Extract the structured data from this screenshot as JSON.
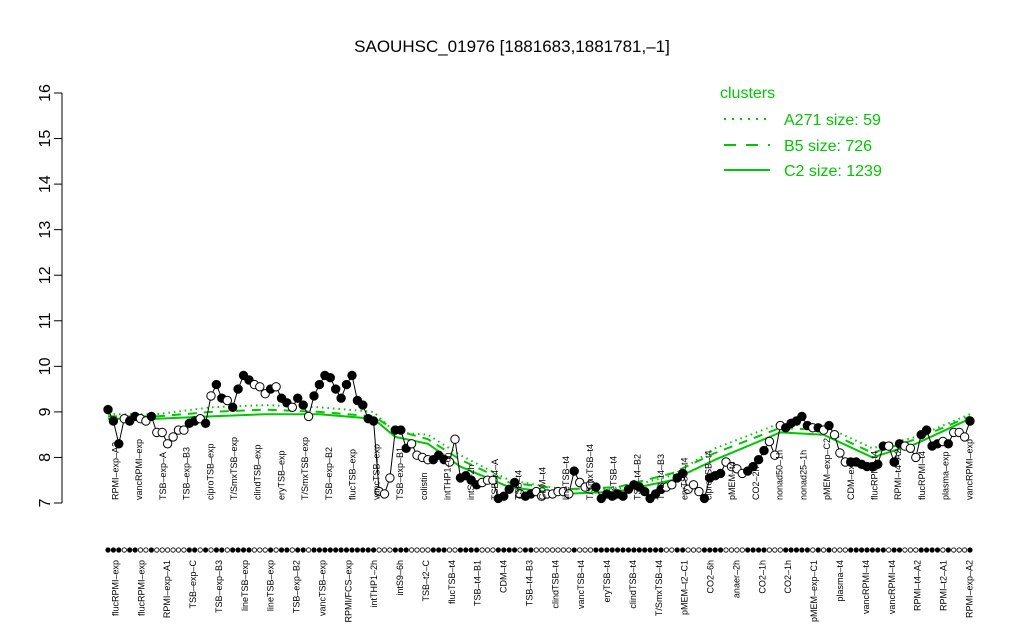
{
  "chart_data": {
    "type": "line",
    "title": "SAOUHSC_01976 [1881683,1881781,–1]",
    "xlabel": "",
    "ylabel": "",
    "ylim": [
      7,
      16
    ],
    "yticks": [
      7,
      8,
      9,
      10,
      11,
      12,
      13,
      14,
      15,
      16
    ],
    "grid": false,
    "legend": {
      "title": "clusters",
      "position": "top-right",
      "entries": [
        {
          "label": "A271 size: 59",
          "style": "dotted"
        },
        {
          "label": "B5 size: 726",
          "style": "dashed"
        },
        {
          "label": "C2 size: 1239",
          "style": "solid"
        }
      ]
    },
    "colors": {
      "series": "#00c800",
      "points": "#000000"
    },
    "top_labels": [
      "RPMI–exp–A2",
      "vancRPMI–exp",
      "TSB–exp–A",
      "TSB–exp–B3",
      "ciproTSB–exp",
      "T/SmxTSB–exp",
      "clindTSB–exp",
      "eryTSB–exp",
      "T/SmxTSB–exp",
      "TSB–exp–B2",
      "flucTSB–exp",
      "vancTSB–exp",
      "TSB–exp–B1",
      "colistin",
      "intTHP1–6h",
      "intS9–2h",
      "TSB–t4–A",
      "TSB–t4",
      "CDM–t4",
      "lineTSB–t4",
      "T/SmxTSB–t4",
      "lineTSB–t4",
      "TSB–t4–B2",
      "TSB–t4–B3",
      "eryTSB–t4",
      "ciproTSB–t4",
      "pMEM–t4",
      "CO2–2h",
      "nonad50–1h",
      "nonad25–1h",
      "pMEM–exp–C2",
      "CDM–exp",
      "flucRPMI–t4",
      "RPMI–t4–A2",
      "flucRPMI–t4",
      "plasma–exp",
      "vancRPMI–exp"
    ],
    "bottom_labels": [
      "flucRPMI–exp",
      "flucRPMI–exp",
      "RPMI–exp–A1",
      "TSB–exp–C",
      "TSB–exp–B3",
      "lineTSB–exp",
      "lineTSB–exp",
      "TSB–exp–B2",
      "vancTSB–exp",
      "RPMI/FCS–exp",
      "intTHP1–2h",
      "intS9–6h",
      "TSB–t2–C",
      "flucTSB–t4",
      "TSB–t4–B1",
      "CDM–t4",
      "TSB–t4–B3",
      "clindTSB–t4",
      "vancTSB–t4",
      "eryTSB–t4",
      "clindTSB–t4",
      "T/SmxTSB–t4",
      "pMEM–t2–C1",
      "CO2–6h",
      "anaer–2h",
      "CO2–1h",
      "CO2–1h",
      "pMEM–exp–C1",
      "plasma–t4",
      "vancRPMI–t4",
      "vancRPMI–t4",
      "RPMI–t4–A2",
      "RPMI–t2–A1",
      "RPMI–exp–A2"
    ],
    "x": [
      1,
      2,
      3,
      4,
      5,
      6,
      7,
      8,
      9,
      10,
      11,
      12,
      13,
      14,
      15,
      16,
      17,
      18,
      19,
      20,
      21,
      22,
      23,
      24,
      25,
      26,
      27,
      28,
      29,
      30,
      31,
      32,
      33,
      34,
      35,
      36,
      37,
      38,
      39,
      40,
      41,
      42,
      43,
      44,
      45,
      46,
      47,
      48,
      49,
      50,
      51,
      52,
      53,
      54,
      55,
      56,
      57,
      58,
      59,
      60,
      61,
      62,
      63,
      64,
      65,
      66,
      67,
      68,
      69,
      70,
      71,
      72,
      73,
      74,
      75,
      76,
      77,
      78,
      79,
      80,
      81,
      82,
      83,
      84,
      85,
      86,
      87,
      88,
      89,
      90,
      91,
      92,
      93,
      94,
      95,
      96,
      97,
      98,
      99,
      100,
      101,
      102,
      103,
      104,
      105,
      106,
      107,
      108,
      109,
      110,
      111,
      112,
      113,
      114,
      115,
      116,
      117,
      118,
      119,
      120,
      121,
      122,
      123,
      124,
      125,
      126,
      127,
      128,
      129,
      130,
      131,
      132,
      133,
      134,
      135,
      136,
      137,
      138,
      139,
      140,
      141,
      142,
      143,
      144,
      145,
      146,
      147,
      148,
      149,
      150,
      151,
      152,
      153,
      154,
      155,
      156,
      157,
      158,
      159,
      160
    ],
    "values": [
      9.05,
      8.8,
      8.3,
      8.85,
      8.8,
      8.9,
      8.85,
      8.8,
      8.9,
      8.55,
      8.55,
      8.3,
      8.45,
      8.6,
      8.6,
      8.75,
      8.8,
      8.85,
      8.75,
      9.35,
      9.6,
      9.3,
      9.25,
      9.1,
      9.5,
      9.8,
      9.7,
      9.6,
      9.55,
      9.4,
      9.5,
      9.55,
      9.3,
      9.2,
      9.1,
      9.3,
      9.15,
      8.9,
      9.35,
      9.6,
      9.8,
      9.75,
      9.5,
      9.3,
      9.6,
      9.8,
      9.25,
      9.15,
      8.85,
      8.8,
      7.25,
      7.2,
      7.55,
      8.6,
      8.6,
      8.2,
      8.3,
      8.05,
      8.0,
      7.95,
      7.95,
      8.05,
      7.95,
      7.9,
      8.4,
      7.55,
      7.6,
      7.5,
      7.4,
      7.45,
      7.5,
      7.5,
      7.1,
      7.15,
      7.3,
      7.45,
      7.2,
      7.15,
      7.2,
      7.25,
      7.15,
      7.2,
      7.2,
      7.25,
      7.25,
      7.2,
      7.7,
      7.45,
      7.35,
      7.4,
      7.35,
      7.1,
      7.2,
      7.15,
      7.2,
      7.15,
      7.3,
      7.4,
      7.35,
      7.25,
      7.1,
      7.2,
      7.3,
      7.35,
      7.4,
      7.55,
      7.65,
      7.3,
      7.4,
      7.25,
      7.1,
      7.55,
      7.6,
      7.65,
      7.9,
      7.8,
      7.75,
      7.65,
      7.7,
      7.8,
      7.95,
      8.15,
      8.35,
      8.05,
      8.7,
      8.65,
      8.75,
      8.8,
      8.9,
      8.7,
      8.65,
      8.65,
      8.6,
      8.7,
      8.5,
      8.1,
      7.9,
      7.9,
      7.9,
      7.85,
      7.8,
      7.8,
      7.85,
      8.25,
      8.25,
      7.9,
      8.3,
      8.25,
      8.2,
      8.0,
      8.5,
      8.6,
      8.25,
      8.3,
      8.35,
      8.3,
      8.55,
      8.55,
      8.45,
      8.8,
      8.9,
      8.85
    ],
    "series": [
      {
        "name": "C2 size: 1239",
        "style": "solid",
        "x": [
          1,
          10,
          20,
          30,
          40,
          50,
          54,
          60,
          66,
          75,
          85,
          95,
          105,
          113,
          125,
          133,
          142,
          150,
          160
        ],
        "values": [
          8.85,
          8.85,
          8.9,
          8.95,
          8.95,
          8.85,
          8.45,
          8.3,
          7.8,
          7.35,
          7.2,
          7.25,
          7.5,
          7.95,
          8.55,
          8.5,
          8.0,
          8.3,
          8.85
        ]
      },
      {
        "name": "B5 size: 726",
        "style": "dashed",
        "x": [
          1,
          10,
          20,
          30,
          40,
          50,
          54,
          60,
          66,
          75,
          85,
          95,
          105,
          113,
          125,
          133,
          142,
          150,
          160
        ],
        "values": [
          8.9,
          8.9,
          9.0,
          9.05,
          9.0,
          8.9,
          8.6,
          8.4,
          7.95,
          7.45,
          7.3,
          7.35,
          7.65,
          8.1,
          8.65,
          8.6,
          8.1,
          8.4,
          8.9
        ]
      },
      {
        "name": "A271 size: 59",
        "style": "dotted",
        "x": [
          1,
          10,
          20,
          30,
          40,
          50,
          54,
          60,
          66,
          75,
          85,
          95,
          105,
          113,
          125,
          133,
          142,
          150,
          160
        ],
        "values": [
          8.95,
          8.95,
          9.1,
          9.15,
          9.1,
          9.0,
          8.55,
          8.5,
          8.05,
          7.5,
          7.3,
          7.3,
          7.6,
          8.2,
          8.75,
          8.7,
          8.2,
          8.45,
          8.95
        ]
      }
    ],
    "rug": [
      1,
      1,
      1,
      0,
      1,
      1,
      0,
      0,
      1,
      0,
      0,
      0,
      0,
      0,
      0,
      1,
      1,
      0,
      1,
      0,
      1,
      1,
      0,
      1,
      1,
      1,
      1,
      0,
      0,
      0,
      1,
      0,
      1,
      1,
      0,
      1,
      1,
      0,
      1,
      1,
      1,
      1,
      1,
      1,
      1,
      1,
      1,
      1,
      1,
      1,
      0,
      0,
      0,
      1,
      1,
      1,
      0,
      0,
      0,
      0,
      1,
      1,
      1,
      0,
      0,
      1,
      1,
      1,
      1,
      0,
      0,
      0,
      1,
      1,
      1,
      1,
      0,
      1,
      1,
      0,
      0,
      0,
      0,
      0,
      0,
      0,
      1,
      0,
      0,
      0,
      1,
      1,
      1,
      1,
      1,
      1,
      1,
      1,
      1,
      1,
      1,
      1,
      1,
      0,
      0,
      1,
      1,
      0,
      0,
      0,
      1,
      1,
      1,
      1,
      0,
      0,
      0,
      0,
      1,
      1,
      1,
      1,
      0,
      0,
      0,
      1,
      1,
      1,
      1,
      1,
      0,
      1,
      0,
      1,
      0,
      0,
      0,
      1,
      1,
      1,
      1,
      1,
      1,
      1,
      0,
      1,
      1,
      0,
      0,
      0,
      1,
      1,
      1,
      1,
      0,
      1,
      0,
      0,
      0,
      1
    ]
  }
}
